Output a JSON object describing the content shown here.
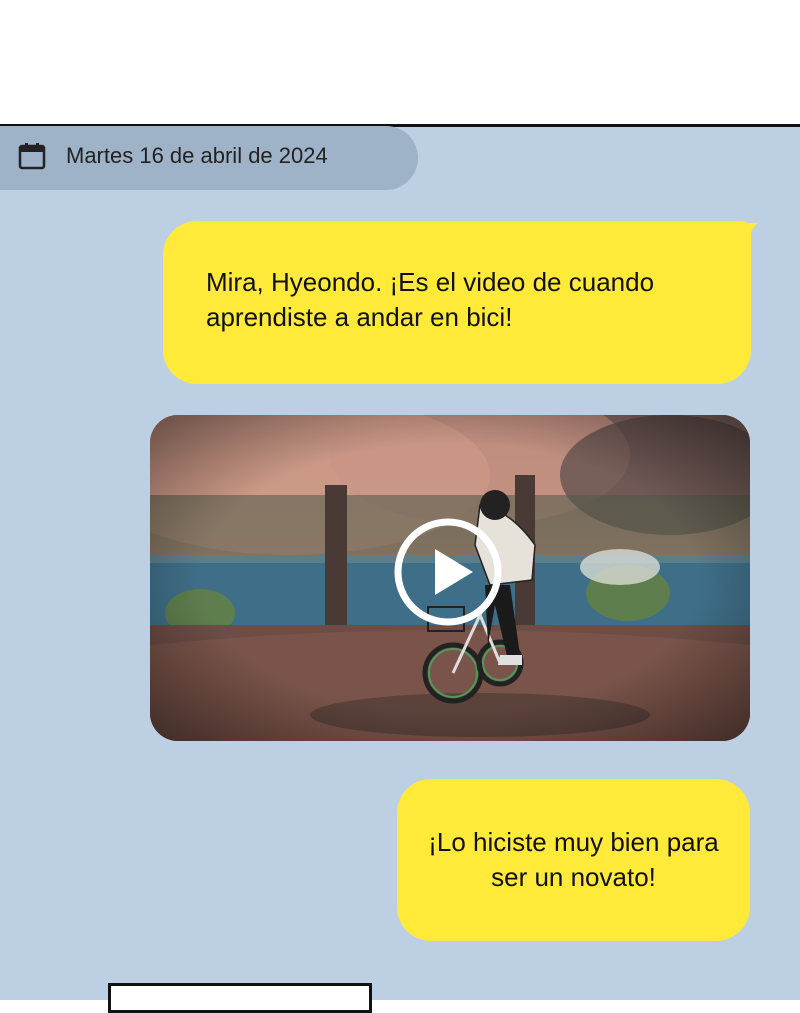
{
  "date_header": {
    "icon": "calendar-icon",
    "text": "Martes 16 de abril de 2024"
  },
  "messages": [
    {
      "type": "text",
      "text": "Mira, Hyeondo. ¡Es el video de cuando aprendiste a andar en bici!"
    },
    {
      "type": "video",
      "description_icon": "play-icon"
    },
    {
      "type": "text",
      "text": "¡Lo hiciste muy bien para ser un novato!"
    }
  ],
  "colors": {
    "chat_background": "#bdd0e3",
    "date_pill": "#9eb3c8",
    "bubble": "#ffea3a",
    "text": "#111111"
  }
}
